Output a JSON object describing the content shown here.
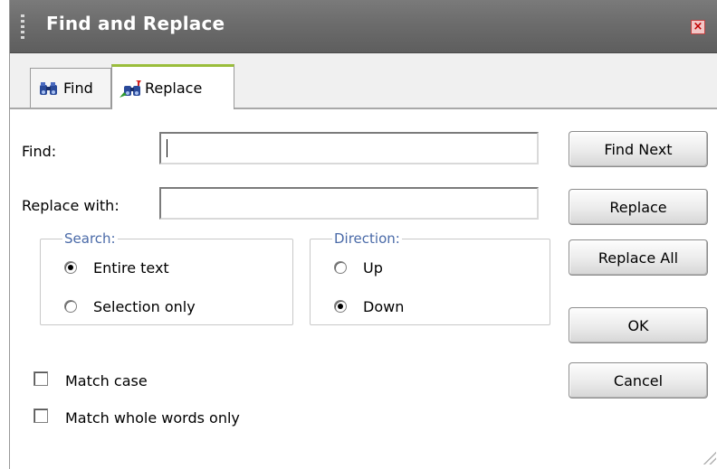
{
  "window": {
    "title": "Find and Replace",
    "close_icon": "close-icon"
  },
  "tabs": [
    {
      "label": "Find",
      "icon": "binoculars-icon",
      "selected": false
    },
    {
      "label": "Replace",
      "icon": "binoculars-replace-icon",
      "selected": true
    }
  ],
  "fields": {
    "find": {
      "label": "Find:",
      "value": ""
    },
    "replace": {
      "label": "Replace with:",
      "value": ""
    }
  },
  "search_group": {
    "legend": "Search:",
    "options": [
      {
        "label": "Entire text",
        "checked": true
      },
      {
        "label": "Selection only",
        "checked": false
      }
    ]
  },
  "direction_group": {
    "legend": "Direction:",
    "options": [
      {
        "label": "Up",
        "checked": false
      },
      {
        "label": "Down",
        "checked": true
      }
    ]
  },
  "checkboxes": [
    {
      "label": "Match case",
      "checked": false
    },
    {
      "label": "Match whole words only",
      "checked": false
    }
  ],
  "buttons": {
    "find_next": "Find Next",
    "replace": "Replace",
    "replace_all": "Replace All",
    "ok": "OK",
    "cancel": "Cancel"
  }
}
